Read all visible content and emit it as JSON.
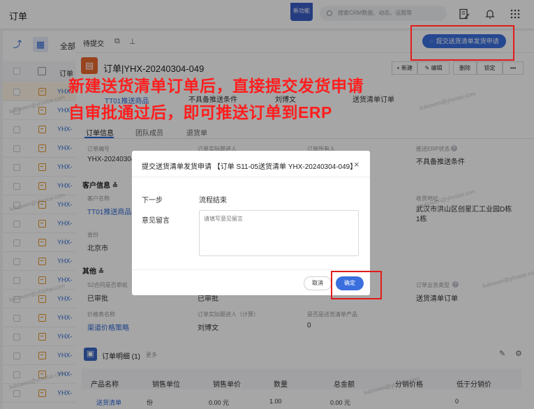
{
  "topbar": {
    "title": "订单",
    "new_feature": "新功能",
    "search_placeholder": "搜索CRM数据、动态、话题等"
  },
  "left": {
    "tab_all": "全部",
    "col_header": "订单",
    "row_prefix": "YHX-"
  },
  "subbar": {
    "status": "待提交"
  },
  "header": {
    "title": "订单|YHX-20240304-049",
    "submit_btn": "提交送货清单发货申请",
    "new_btn": "+ 新建",
    "edit_btn": "编辑",
    "delete_btn": "删除",
    "lock_btn": "锁定",
    "more_btn": "•••",
    "summary_vals": [
      "TT01推送商品",
      "不具备推送条件",
      "刘博文",
      "送货清单订单"
    ]
  },
  "annotation": {
    "line1": "新建送货清单订单后，直接提交发货申请",
    "line2": "自审批通过后，即可推送订单到ERP"
  },
  "tabs": [
    "订单信息",
    "团队成员",
    "退货单"
  ],
  "info": {
    "order_no_label": "订单编号",
    "order_no": "YHX-20240304-",
    "actual_sales_label": "订单实际跟进人",
    "owner_label": "订单所有人",
    "erp_label": "推送ERP状态",
    "erp_value": "不具备推送条件",
    "customer_section": "客户信息",
    "customer_label": "客户名称",
    "customer_value": "TT01推送商品专",
    "address_label": "收货地址",
    "address_value": "武汉市洪山区创星汇工业园D栋1栋",
    "province_label": "省份",
    "province_value": "北京市",
    "other_section": "其他",
    "approve_label": "S2合同是否审批",
    "approve_value": "已审批",
    "approve_value2": "已审批",
    "biz_type_label": "订单业务类型",
    "biz_type_value": "送货清单订单",
    "price_label": "价格表名称",
    "price_value": "渠道价格策略",
    "actual_calc_label": "订单实际跟进人（计算）",
    "actual_calc_value": "刘博文",
    "is_delivery_label": "是否是送货清单产品",
    "is_delivery_value": "0"
  },
  "detail": {
    "title": "订单明细",
    "count": "(1)",
    "more": "更多",
    "headers": [
      "产品名称",
      "销售单位",
      "销售单价",
      "数量",
      "总金额",
      "分销价格",
      "低于分销价"
    ],
    "row": [
      "送货清单",
      "份",
      "0.00 元",
      "1.00",
      "0.00 元",
      "",
      "0"
    ]
  },
  "dialog": {
    "title": "提交送货清单发货申请 【订单 S11-05送货清单 YHX-20240304-049】",
    "next_step_label": "下一步",
    "next_step_value": "流程结束",
    "comment_label": "意见留言",
    "comment_placeholder": "请填写意见留言",
    "cancel": "取消",
    "confirm": "确定"
  },
  "watermark": "liubowen@yhxstar.com"
}
